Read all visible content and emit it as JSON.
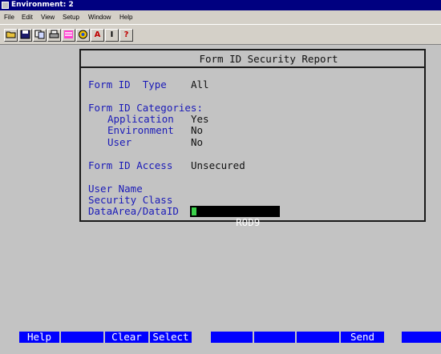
{
  "window": {
    "title": "Environment: 2"
  },
  "menu": [
    "File",
    "Edit",
    "View",
    "Setup",
    "Window",
    "Help"
  ],
  "toolbar": {
    "buttons": [
      {
        "icon": "open-folder-icon"
      },
      {
        "icon": "save-disk-icon"
      },
      {
        "icon": "copy-icon"
      },
      {
        "icon": "print-icon"
      },
      {
        "icon": "color-palette-icon"
      },
      {
        "icon": "settings-wheel-icon"
      },
      {
        "icon": "font-icon",
        "glyph": "A"
      },
      {
        "icon": "text-cursor-icon",
        "glyph": "I"
      },
      {
        "icon": "help-icon",
        "glyph": "?"
      }
    ]
  },
  "report": {
    "title": "Form ID Security Report",
    "form_id_type_label": "Form ID  Type",
    "form_id_type_value": "All",
    "categories_label": "Form ID Categories:",
    "application_label": "Application",
    "application_value": "Yes",
    "environment_label": "Environment",
    "environment_value": "No",
    "user_label": "User",
    "user_value": "No",
    "access_label": "Form ID Access",
    "access_value": "Unsecured",
    "user_name_label": "User Name",
    "security_class_label": "Security Class",
    "dataarea_label": "DataArea/DataID",
    "dataarea_value": "ROD9"
  },
  "function_keys": [
    "Help",
    "",
    "Clear",
    "Select",
    "",
    "",
    "",
    "",
    "Send",
    ""
  ],
  "colors": {
    "background": "#c3c3c3",
    "label_blue": "#1a1ab8",
    "fkey_blue": "#0000ff",
    "titlebar": "#000080",
    "cursor_green": "#3bd04a"
  }
}
